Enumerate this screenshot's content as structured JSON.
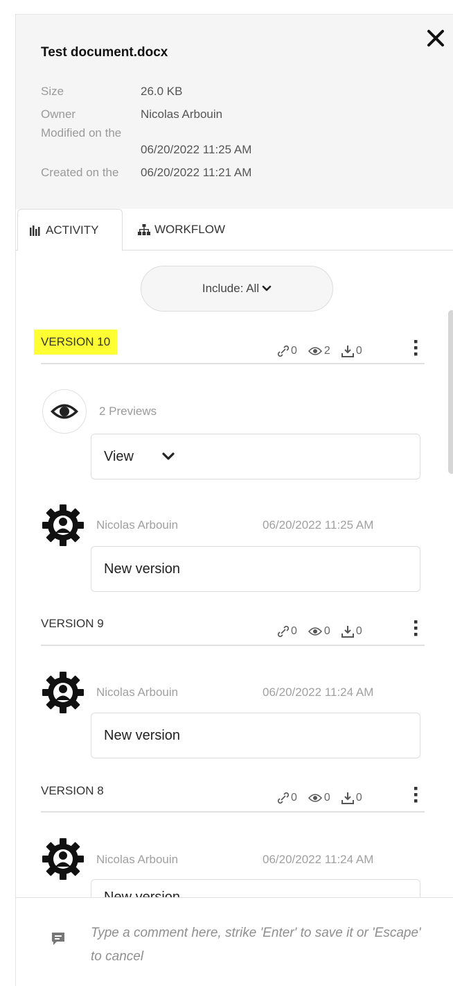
{
  "document": {
    "title": "Test document.docx",
    "meta": [
      {
        "label": "Size",
        "value": "26.0 KB"
      },
      {
        "label": "Owner",
        "value": "Nicolas Arbouin"
      },
      {
        "label": "Modified on the",
        "value": "06/20/2022 11:25 AM"
      },
      {
        "label": "Created on the",
        "value": "06/20/2022 11:21 AM"
      }
    ]
  },
  "tabs": [
    {
      "label": "ACTIVITY",
      "icon": "bar-chart-icon",
      "active": true
    },
    {
      "label": "WORKFLOW",
      "icon": "sitemap-icon",
      "active": false
    }
  ],
  "filter": {
    "label": "Include: All"
  },
  "versions": [
    {
      "label": "VERSION 10",
      "highlighted": true,
      "stats": {
        "links": "0",
        "views": "2",
        "downloads": "0"
      },
      "preview": {
        "text": "2 Previews",
        "select": "View"
      },
      "author": "Nicolas Arbouin",
      "date": "06/20/2022 11:25 AM",
      "comment": "New version"
    },
    {
      "label": "VERSION 9",
      "highlighted": false,
      "stats": {
        "links": "0",
        "views": "0",
        "downloads": "0"
      },
      "author": "Nicolas Arbouin",
      "date": "06/20/2022 11:24 AM",
      "comment": "New version"
    },
    {
      "label": "VERSION 8",
      "highlighted": false,
      "stats": {
        "links": "0",
        "views": "0",
        "downloads": "0"
      },
      "author": "Nicolas Arbouin",
      "date": "06/20/2022 11:24 AM",
      "comment": "New version"
    }
  ],
  "footer": {
    "placeholder": "Type a comment here, strike 'Enter' to save it or 'Escape' to cancel"
  },
  "colors": {
    "highlight": "#ffff33",
    "header_bg": "#f5f5f5"
  }
}
